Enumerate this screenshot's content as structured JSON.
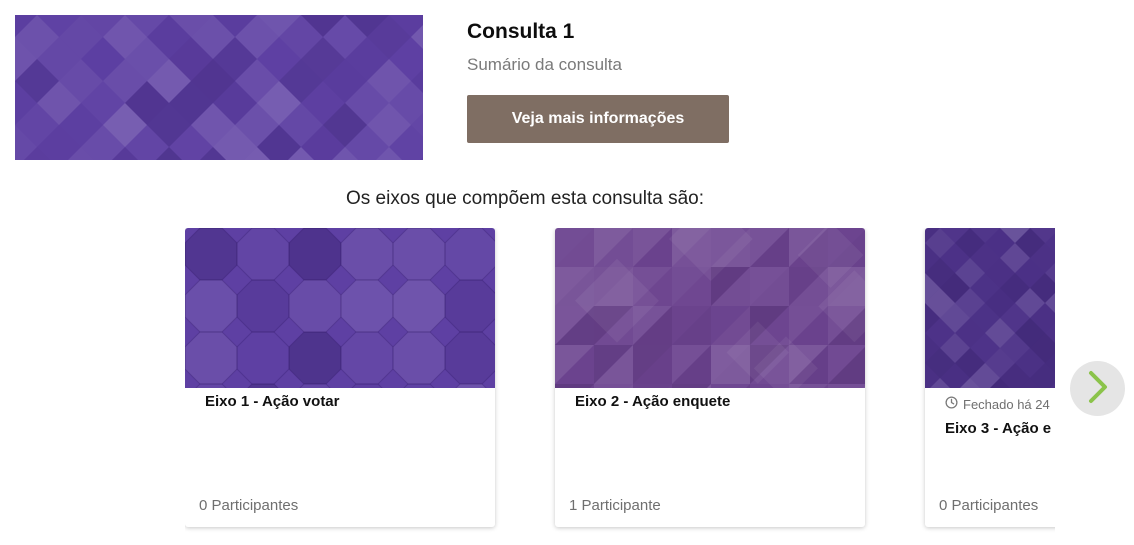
{
  "consultation": {
    "title": "Consulta 1",
    "summary": "Sumário da consulta",
    "more_info_button": "Veja mais informações"
  },
  "axes_section": {
    "label": "Os eixos que compõem esta consulta são:"
  },
  "axes": [
    {
      "title": "Eixo 1 - Ação votar",
      "participants": "0 Participantes"
    },
    {
      "title": "Eixo 2 - Ação enquete",
      "participants": "1 Participante"
    },
    {
      "title": "Eixo 3 - Ação e",
      "participants": "0 Participantes",
      "status": "Fechado há 24"
    }
  ],
  "colors": {
    "button_bg": "#7f6e63",
    "purple_dark": "#4e3389",
    "purple_mid": "#5e40a3",
    "purple_muted": "#6d4590",
    "next_arrow": "#8bc34a"
  },
  "icons": {
    "status": "clock-icon",
    "carousel_next": "chevron-right-icon"
  }
}
